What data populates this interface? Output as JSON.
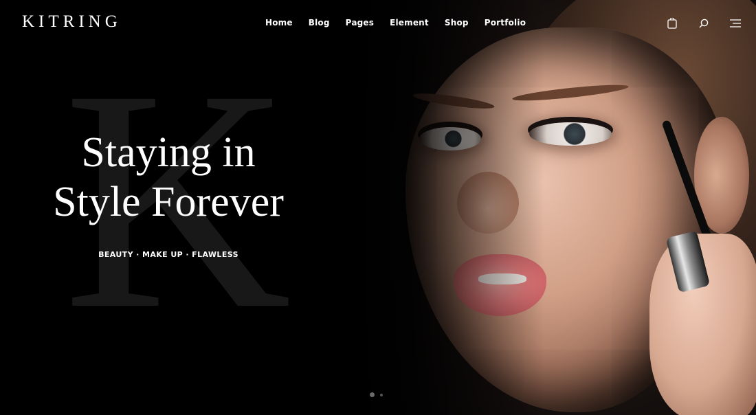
{
  "brand": {
    "logo_text": "KITRING"
  },
  "nav": {
    "items": [
      "Home",
      "Blog",
      "Pages",
      "Element",
      "Shop",
      "Portfolio"
    ]
  },
  "header_icons": [
    "shopping-bag-icon",
    "search-icon",
    "menu-icon"
  ],
  "hero": {
    "watermark_letter": "K",
    "headline_line1": "Staying in",
    "headline_line2": "Style Forever",
    "subline": "BEAUTY · MAKE UP · FLAWLESS"
  },
  "slider": {
    "slides": 2,
    "active_index": 0
  },
  "colors": {
    "background": "#000000",
    "text": "#ffffff",
    "watermark": "#1b1b1b"
  }
}
